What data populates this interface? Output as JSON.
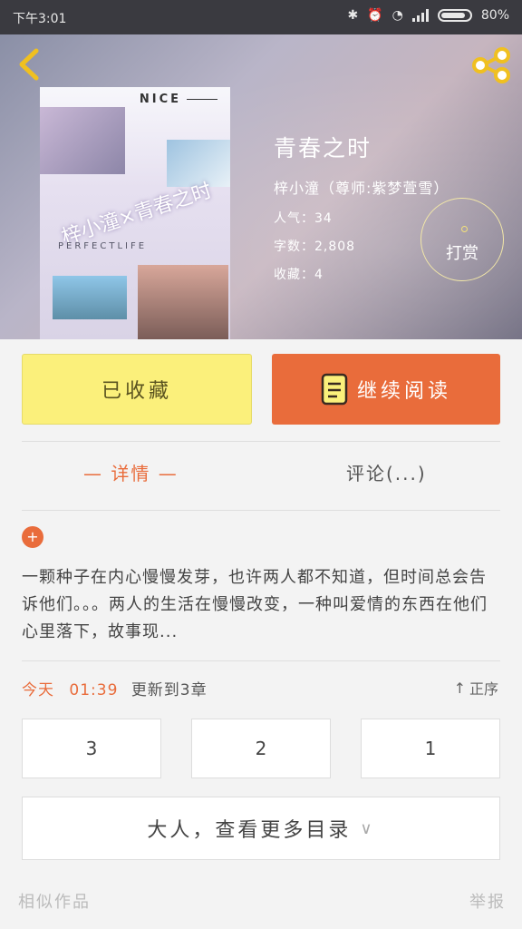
{
  "status_bar": {
    "time": "下午3:01",
    "battery": "80%"
  },
  "book": {
    "title": "青春之时",
    "author": "梓小潼（尊师:紫梦萱雪）",
    "popularity": "人气：34",
    "word_count": "字数：2,808",
    "favorites": "收藏：4",
    "tip_label": "打赏"
  },
  "cover": {
    "badge": "NICE",
    "overlay_title": "梓小潼×青春之时",
    "subtitle": "PERFECTLIFE"
  },
  "actions": {
    "collect_label": "已收藏",
    "read_label": "继续阅读"
  },
  "tabs": {
    "detail": "— 详情 —",
    "comments": "评论(...)"
  },
  "description": "一颗种子在内心慢慢发芽，也许两人都不知道，但时间总会告诉他们。。。两人的生活在慢慢改变，一种叫爱情的东西在他们心里落下，故事现...",
  "update": {
    "today": "今天",
    "time": "01:39",
    "text": "更新到3章",
    "order_label": "正序"
  },
  "chapters": [
    "3",
    "2",
    "1"
  ],
  "more_catalog": "大人，查看更多目录",
  "footer": {
    "similar": "相似作品",
    "report": "举报"
  },
  "colors": {
    "accent": "#e96c3b",
    "collect_bg": "#fbf07b"
  }
}
